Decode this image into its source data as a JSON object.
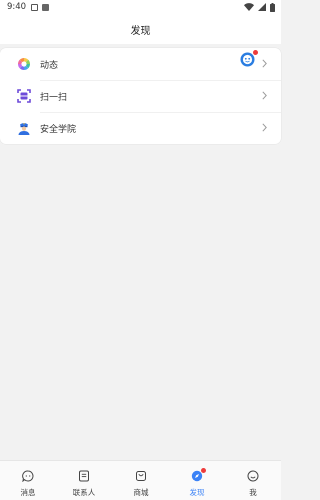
{
  "status_bar": {
    "time": "9:40"
  },
  "header": {
    "title": "发现"
  },
  "menu": {
    "items": [
      {
        "label": "动态",
        "icon": "pinwheel-icon"
      },
      {
        "label": "扫一扫",
        "icon": "scan-icon"
      },
      {
        "label": "安全学院",
        "icon": "police-officer-icon"
      }
    ]
  },
  "tabbar": {
    "tabs": [
      {
        "label": "消息",
        "icon": "chat-bubble-icon"
      },
      {
        "label": "联系人",
        "icon": "contacts-icon"
      },
      {
        "label": "商城",
        "icon": "shop-icon"
      },
      {
        "label": "发现",
        "icon": "compass-icon"
      },
      {
        "label": "我",
        "icon": "smile-icon"
      }
    ],
    "active_index": 3
  },
  "colors": {
    "accent": "#3b82f6",
    "badge": "#ee3b3b"
  }
}
